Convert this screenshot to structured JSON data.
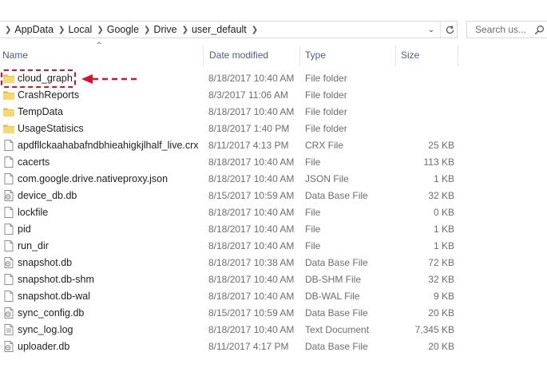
{
  "address": {
    "crumbs": [
      "AppData",
      "Local",
      "Google",
      "Drive",
      "user_default"
    ]
  },
  "search": {
    "placeholder": "Search us..."
  },
  "columns": {
    "name": "Name",
    "date": "Date modified",
    "type": "Type",
    "size": "Size"
  },
  "files": [
    {
      "name": "cloud_graph",
      "date": "8/18/2017 10:40 AM",
      "type": "File folder",
      "size": "",
      "icon": "folder-icon"
    },
    {
      "name": "CrashReports",
      "date": "8/3/2017 11:06 AM",
      "type": "File folder",
      "size": "",
      "icon": "folder-icon"
    },
    {
      "name": "TempData",
      "date": "8/18/2017 10:40 AM",
      "type": "File folder",
      "size": "",
      "icon": "folder-icon"
    },
    {
      "name": "UsageStatisics",
      "date": "8/18/2017 1:40 PM",
      "type": "File folder",
      "size": "",
      "icon": "folder-icon"
    },
    {
      "name": "apdfllckaahabafndbhieahigkjlhalf_live.crx",
      "date": "8/11/2017 4:13 PM",
      "type": "CRX File",
      "size": "25 KB",
      "icon": "file-icon"
    },
    {
      "name": "cacerts",
      "date": "8/18/2017 10:40 AM",
      "type": "File",
      "size": "113 KB",
      "icon": "file-icon"
    },
    {
      "name": "com.google.drive.nativeproxy.json",
      "date": "8/18/2017 10:40 AM",
      "type": "JSON File",
      "size": "1 KB",
      "icon": "file-icon"
    },
    {
      "name": "device_db.db",
      "date": "8/15/2017 10:59 AM",
      "type": "Data Base File",
      "size": "32 KB",
      "icon": "database-file-icon"
    },
    {
      "name": "lockfile",
      "date": "8/18/2017 10:40 AM",
      "type": "File",
      "size": "0 KB",
      "icon": "file-icon"
    },
    {
      "name": "pid",
      "date": "8/18/2017 10:40 AM",
      "type": "File",
      "size": "1 KB",
      "icon": "file-icon"
    },
    {
      "name": "run_dir",
      "date": "8/18/2017 10:40 AM",
      "type": "File",
      "size": "1 KB",
      "icon": "file-icon"
    },
    {
      "name": "snapshot.db",
      "date": "8/18/2017 10:38 AM",
      "type": "Data Base File",
      "size": "72 KB",
      "icon": "database-file-icon"
    },
    {
      "name": "snapshot.db-shm",
      "date": "8/18/2017 10:40 AM",
      "type": "DB-SHM File",
      "size": "32 KB",
      "icon": "file-icon"
    },
    {
      "name": "snapshot.db-wal",
      "date": "8/18/2017 10:40 AM",
      "type": "DB-WAL File",
      "size": "9 KB",
      "icon": "file-icon"
    },
    {
      "name": "sync_config.db",
      "date": "8/15/2017 10:59 AM",
      "type": "Data Base File",
      "size": "20 KB",
      "icon": "database-file-icon"
    },
    {
      "name": "sync_log.log",
      "date": "8/18/2017 10:40 AM",
      "type": "Text Document",
      "size": "7,345 KB",
      "icon": "text-document-icon"
    },
    {
      "name": "uploader.db",
      "date": "8/11/2017 4:17 PM",
      "type": "Data Base File",
      "size": "20 KB",
      "icon": "database-file-icon"
    }
  ],
  "colors": {
    "folder": "#f8d775",
    "folder_dark": "#e2b53f",
    "highlight": "#e0102a",
    "header_text": "#4c607a"
  }
}
